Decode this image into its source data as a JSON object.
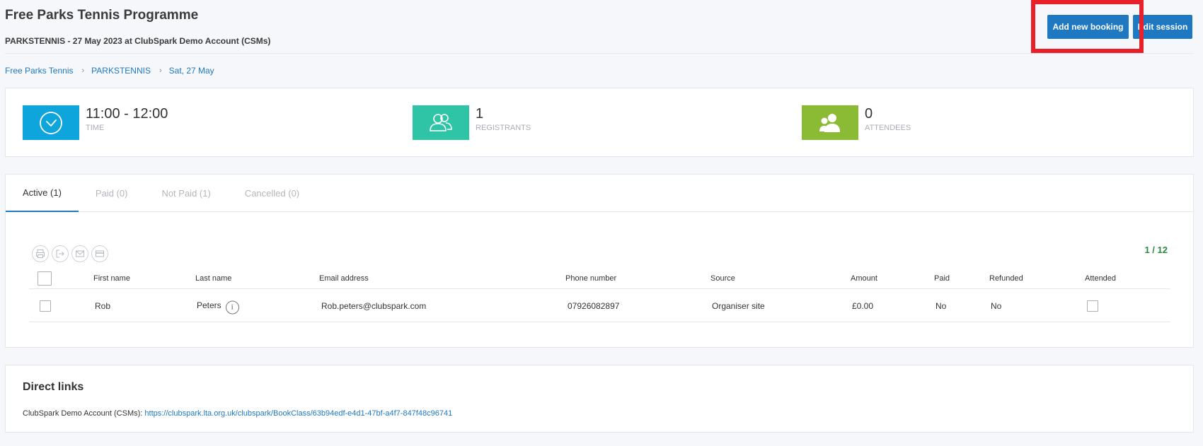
{
  "header": {
    "title": "Free Parks Tennis Programme",
    "subtitle": "PARKSTENNIS - 27 May 2023 at ClubSpark Demo Account (CSMs)",
    "add_booking_label": "Add new booking",
    "edit_session_label": "Edit session"
  },
  "breadcrumb": [
    {
      "label": "Free Parks Tennis"
    },
    {
      "label": "PARKSTENNIS"
    },
    {
      "label": "Sat, 27 May"
    }
  ],
  "breadcrumb_separator": "›",
  "stats": [
    {
      "value": "11:00 - 12:00",
      "label": "TIME",
      "icon": "clock-icon",
      "color": "#0ea5dc"
    },
    {
      "value": "1",
      "label": "REGISTRANTS",
      "icon": "users-icon",
      "color": "#2fc4a6"
    },
    {
      "value": "0",
      "label": "ATTENDEES",
      "icon": "attendees-icon",
      "color": "#8bbb35"
    }
  ],
  "tabs": [
    {
      "label": "Active (1)",
      "active": true
    },
    {
      "label": "Paid (0)",
      "active": false
    },
    {
      "label": "Not Paid (1)",
      "active": false
    },
    {
      "label": "Cancelled (0)",
      "active": false
    }
  ],
  "toolbar_icons": [
    "print-icon",
    "export-icon",
    "email-icon",
    "card-icon"
  ],
  "pagination": "1 / 12",
  "table": {
    "columns": [
      "First name",
      "Last name",
      "Email address",
      "Phone number",
      "Source",
      "Amount",
      "Paid",
      "Refunded",
      "Attended"
    ],
    "rows": [
      {
        "first_name": "Rob",
        "last_name": "Peters",
        "info_glyph": "i",
        "email": "Rob.peters@clubspark.com",
        "phone": "07926082897",
        "source": "Organiser site",
        "amount": "£0.00",
        "paid": "No",
        "refunded": "No"
      }
    ]
  },
  "direct_links": {
    "title": "Direct links",
    "venue": "ClubSpark Demo Account (CSMs):",
    "url": "https://clubspark.lta.org.uk/clubspark/BookClass/63b94edf-e4d1-47bf-a4f7-847f48c96741"
  },
  "colors": {
    "primary": "#1e78c2",
    "highlight": "#e8202a",
    "pagination": "#2b8a3e"
  }
}
